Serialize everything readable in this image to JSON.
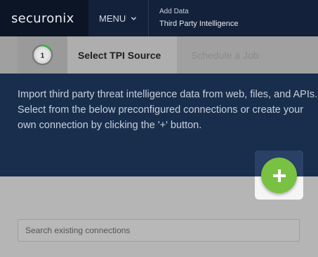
{
  "header": {
    "logo": "securonix",
    "menu_label": "MENU",
    "breadcrumb_parent": "Add Data",
    "breadcrumb_current": "Third Party Intelligence"
  },
  "steps": {
    "current_number": "1",
    "current_label": "Select TPI Source",
    "next_label": "Schedule a Job"
  },
  "info": {
    "text": "Import third party threat intelligence data from web, files, and APIs. Select from the below preconfigured connections or create your own connection by clicking the '+' button."
  },
  "search": {
    "placeholder": "Search existing connections",
    "value": ""
  },
  "colors": {
    "accent_green": "#79c142",
    "header_navy": "#13213a",
    "info_navy": "#192e4c"
  }
}
